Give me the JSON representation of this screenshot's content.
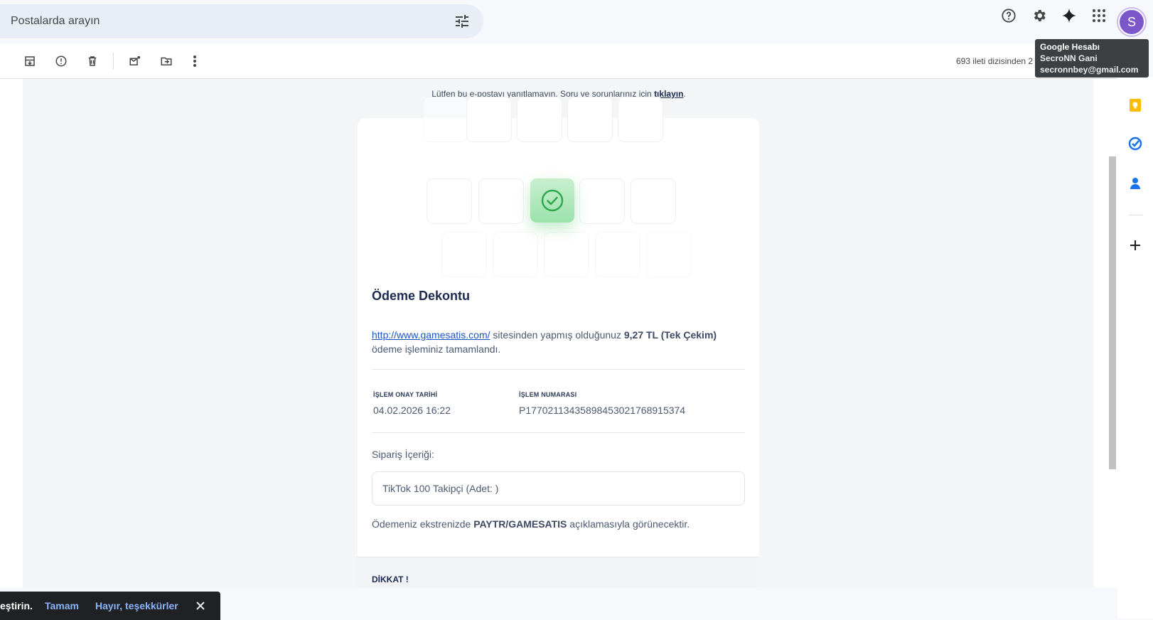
{
  "search": {
    "placeholder": "Postalarda arayın",
    "options_icon": "tune-icon"
  },
  "header": {
    "icons": [
      "help-icon",
      "settings-gear-icon",
      "gemini-sparkle-icon",
      "apps-grid-icon"
    ],
    "avatar_letter": "S",
    "avatar_color": "#7b57c9"
  },
  "tooltip": {
    "title": "Google Hesabı",
    "name": "SecroNN Gani",
    "email": "secronnbey@gmail.com"
  },
  "toolbar": {
    "icons": [
      "archive-icon",
      "report-spam-icon",
      "delete-icon",
      "mark-unread-icon",
      "move-to-icon",
      "more-vert-icon"
    ],
    "counter": "693 ileti dizisinden 2"
  },
  "mail": {
    "noreply_text": "Lütfen bu e-postayı yanıtlamayın. Soru ve sorunlarınız için ",
    "noreply_link": "tıklayın",
    "noreply_end": ".",
    "title": "Ödeme Dekontu",
    "site_link": "http://www.gamesatis.com/",
    "p1_mid": " sitesinden yapmış olduğunuz ",
    "amount": "9,27 TL (Tek Çekim)",
    "p1_end": "ödeme işleminiz tamamlandı.",
    "date_label": "İŞLEM ONAY TARİHİ",
    "date_value": "04.02.2026 16:22",
    "txn_label": "İŞLEM NUMARASI",
    "txn_value": "P1770211343589845302176891537​4",
    "order_label": "Sipariş İçeriği:",
    "order_item": "TikTok 100 Takipçi (Adet: )",
    "p2_start": "Ödemeniz ekstrenizde ",
    "p2_bold": "PAYTR/GAMESATIS",
    "p2_end": " açıklamasıyla görünecektir.",
    "warning_title": "DİKKAT !",
    "accent_success": "#2fa84f",
    "link_color": "#1a55c7"
  },
  "sidepanel": {
    "icons": [
      "calendar-icon",
      "keep-icon",
      "tasks-icon",
      "contacts-icon",
      "add-icon"
    ]
  },
  "snackbar": {
    "text": "eştirin.",
    "ok": "Tamam",
    "no": "Hayır, teşekkürler",
    "close_icon": "close-icon"
  }
}
